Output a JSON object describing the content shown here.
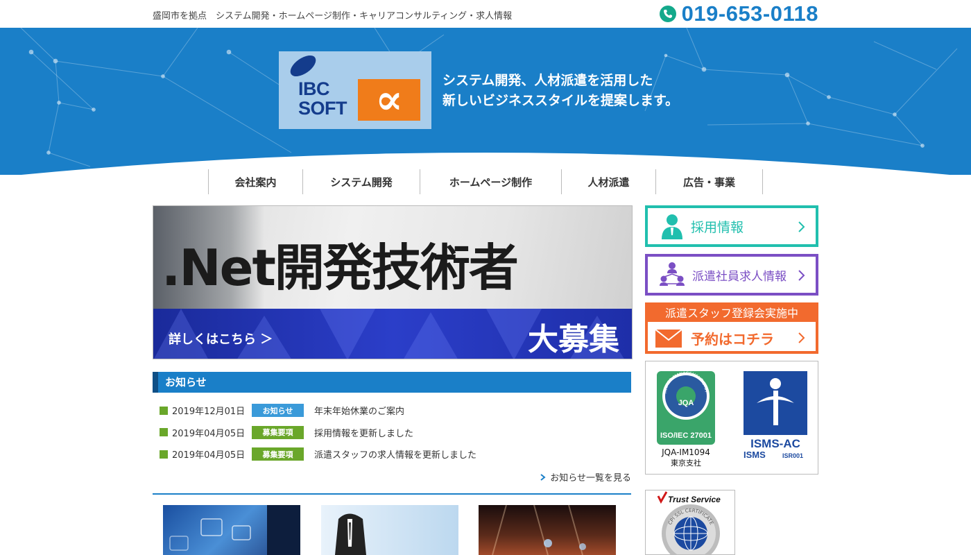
{
  "header": {
    "tagline": "盛岡市を拠点　システム開発・ホームページ制作・キャリアコンサルティング・求人情報",
    "phone": "019-653-0118",
    "phone_icon": "phone-icon"
  },
  "hero": {
    "logo_text_line1": "IBC",
    "logo_text_line2": "SOFT",
    "logo_symbol": "∝",
    "slogan_line1": "システム開発、人材派遣を活用した",
    "slogan_line2": "新しいビジネススタイルを提案します。"
  },
  "nav": {
    "items": [
      {
        "label": "会社案内"
      },
      {
        "label": "システム開発"
      },
      {
        "label": "ホームページ制作"
      },
      {
        "label": "人材派遣"
      },
      {
        "label": "広告・事業"
      }
    ]
  },
  "banner": {
    "title": ".Net開発技術者",
    "link": "詳しくはこちら ＞",
    "big": "大募集"
  },
  "news": {
    "heading": "お知らせ",
    "items": [
      {
        "date": "2019年12月01日",
        "badge": "お知らせ",
        "badge_color": "#3a9ad9",
        "text": "年末年始休業のご案内"
      },
      {
        "date": "2019年04月05日",
        "badge": "募集要項",
        "badge_color": "#6aa72a",
        "text": "採用情報を更新しました"
      },
      {
        "date": "2019年04月05日",
        "badge": "募集要項",
        "badge_color": "#6aa72a",
        "text": "派遣スタッフの求人情報を更新しました"
      }
    ],
    "more": "お知らせ一覧を見る"
  },
  "sidebar": {
    "recruit": {
      "label": "採用情報",
      "color": "#21bfae"
    },
    "dispatch": {
      "label": "派遣社員求人情報",
      "color": "#7b4fc4"
    },
    "register": {
      "top": "派遣スタッフ登録会実施中",
      "label": "予約はコチラ",
      "color": "#f26a2e"
    },
    "certs": {
      "jqa_ring": "CERTIFIED MANAGEMENT SYSTEM",
      "jqa_mark": "JQA",
      "jqa_std": "ISO/IEC 27001",
      "jqa_id": "JQA-IM1094",
      "jqa_branch": "東京支社",
      "isms_name": "ISMS-AC",
      "isms_sub": "ISMS",
      "isms_code": "ISR001"
    },
    "trust": {
      "title": "Trust Service",
      "ring": "CPI SSL CERTIFICATE"
    }
  },
  "colors": {
    "primary": "#1a7fc8",
    "accent_orange": "#f07c1a",
    "green": "#6aa72a"
  }
}
